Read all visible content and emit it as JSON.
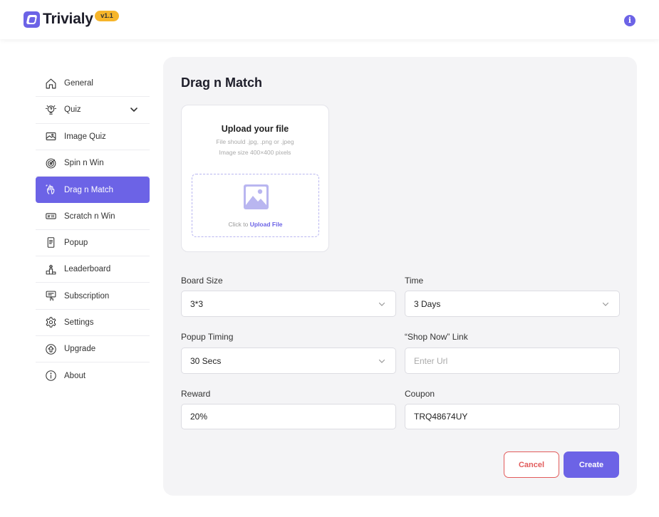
{
  "header": {
    "brand": "Trivialy",
    "version": "v1.1",
    "info_glyph": "i"
  },
  "sidebar": {
    "items": [
      {
        "label": "General",
        "icon": "home-icon"
      },
      {
        "label": "Quiz",
        "icon": "quiz-icon",
        "expandable": true
      },
      {
        "label": "Image Quiz",
        "icon": "image-icon"
      },
      {
        "label": "Spin n Win",
        "icon": "target-icon"
      },
      {
        "label": "Drag n Match",
        "icon": "hand-icon",
        "active": true
      },
      {
        "label": "Scratch n Win",
        "icon": "ticket-icon"
      },
      {
        "label": "Popup",
        "icon": "popup-icon"
      },
      {
        "label": "Leaderboard",
        "icon": "podium-icon"
      },
      {
        "label": "Subscription",
        "icon": "subscription-icon"
      },
      {
        "label": "Settings",
        "icon": "gear-icon"
      },
      {
        "label": "Upgrade",
        "icon": "upgrade-icon"
      },
      {
        "label": "About",
        "icon": "about-icon"
      }
    ]
  },
  "main": {
    "title": "Drag n Match",
    "upload": {
      "title": "Upload your file",
      "hint_type": "File should .jpg, .png or .jpeg",
      "hint_size": "Image size 400×400 pixels",
      "click_prefix": "Click to",
      "click_link": "Upload File"
    },
    "form": {
      "board_size": {
        "label": "Board Size",
        "value": "3*3"
      },
      "time": {
        "label": "Time",
        "value": "3 Days"
      },
      "popup_timing": {
        "label": "Popup Timing",
        "value": "30 Secs"
      },
      "shop_link": {
        "label": "“Shop Now” Link",
        "placeholder": "Enter Url"
      },
      "reward": {
        "label": "Reward",
        "value": "20%"
      },
      "coupon": {
        "label": "Coupon",
        "value": "TRQ48674UY"
      }
    },
    "actions": {
      "cancel": "Cancel",
      "create": "Create"
    }
  },
  "colors": {
    "accent": "#6c63e6",
    "cancel": "#e25b5b",
    "version_badge": "#f6b52a",
    "panel_bg": "#f4f4f6"
  }
}
